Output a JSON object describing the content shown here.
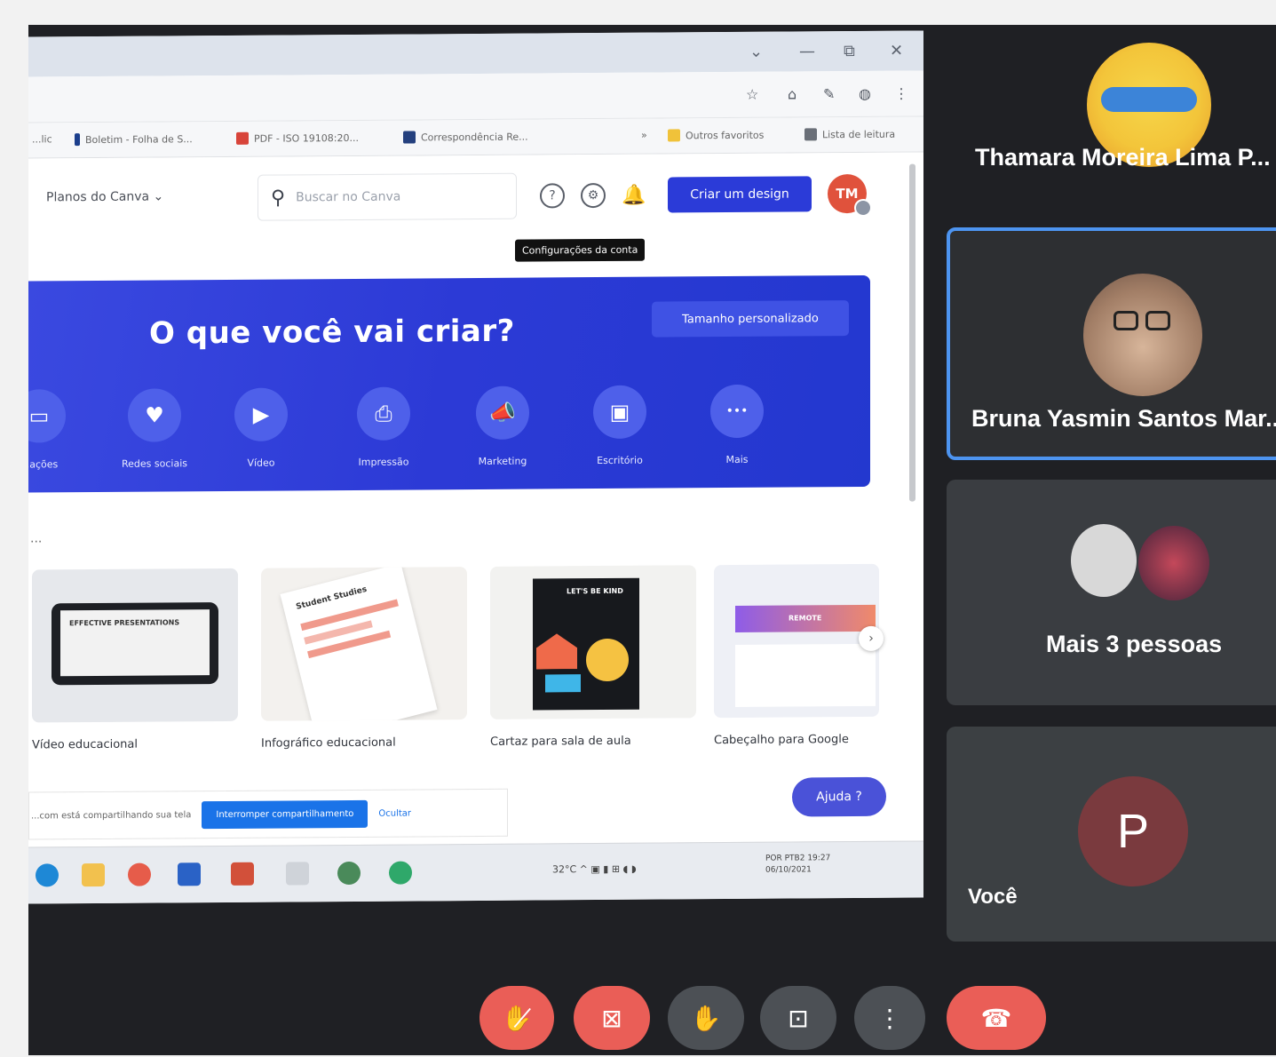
{
  "browser": {
    "window_controls": [
      "⌄",
      "—",
      "⧉",
      "✕"
    ],
    "bookmarks": [
      "...lic",
      "Boletim - Folha de S...",
      "PDF - ISO 19108:20...",
      "Correspondência Re...",
      "»",
      "Outros favoritos",
      "Lista de leitura"
    ]
  },
  "canva": {
    "plans_menu": "Planos do Canva ⌄",
    "search_placeholder": "Buscar no Canva",
    "create_button": "Criar um design",
    "user_initials": "TM",
    "tooltip": "Configurações da conta",
    "hero": {
      "title": "O que você vai criar?",
      "custom_size": "Tamanho personalizado",
      "categories": [
        {
          "label": "...ações",
          "icon": "presentation-icon",
          "glyph": "▭"
        },
        {
          "label": "Redes sociais",
          "icon": "heart-icon",
          "glyph": "♥"
        },
        {
          "label": "Vídeo",
          "icon": "video-icon",
          "glyph": "▶"
        },
        {
          "label": "Impressão",
          "icon": "printer-icon",
          "glyph": "⎙"
        },
        {
          "label": "Marketing",
          "icon": "megaphone-icon",
          "glyph": "📣"
        },
        {
          "label": "Escritório",
          "icon": "briefcase-icon",
          "glyph": "▣"
        },
        {
          "label": "Mais",
          "icon": "more-icon",
          "glyph": "•••"
        }
      ]
    },
    "recommend_heading": "...",
    "cards": [
      {
        "caption": "Vídeo educacional",
        "thumb_text": "EFFECTIVE PRESENTATIONS"
      },
      {
        "caption": "Infográfico educacional",
        "thumb_text": "Student Studies"
      },
      {
        "caption": "Cartaz para sala de aula",
        "thumb_text": "LET'S BE KIND"
      },
      {
        "caption": "Cabeçalho para Google",
        "thumb_text": "REMOTE"
      }
    ],
    "share_notice": "...com está compartilhando sua tela",
    "stop_sharing": "Interromper compartilhamento",
    "hide": "Ocultar",
    "help_button": "Ajuda ?"
  },
  "taskbar": {
    "weather": "32°C",
    "lang": "POR PTB2",
    "time": "19:27",
    "date": "06/10/2021"
  },
  "meet": {
    "participants": [
      {
        "name": "Thamara Moreira Lima P..."
      },
      {
        "name": "Bruna Yasmin Santos Mar..."
      },
      {
        "name": "Mais 3 pessoas"
      },
      {
        "name": "Você",
        "initial": "P"
      }
    ],
    "controls": [
      "mic-off-icon",
      "camera-off-icon",
      "raise-hand-icon",
      "present-icon",
      "more-options-icon",
      "end-call-icon"
    ]
  }
}
